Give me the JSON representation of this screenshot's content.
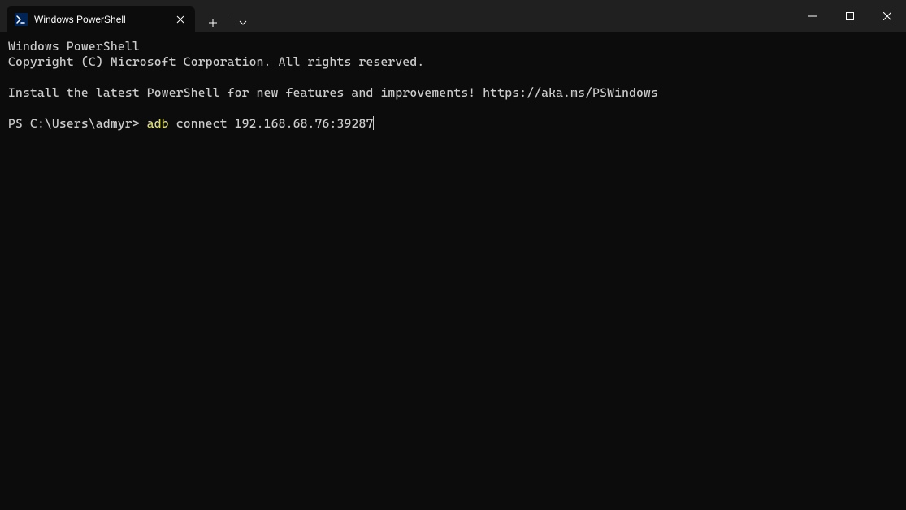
{
  "tab": {
    "title": "Windows PowerShell"
  },
  "terminal": {
    "line1": "Windows PowerShell",
    "line2": "Copyright (C) Microsoft Corporation. All rights reserved.",
    "line3": "Install the latest PowerShell for new features and improvements! https://aka.ms/PSWindows",
    "prompt": "PS C:\\Users\\admyr> ",
    "command_highlight": "adb",
    "command_rest": " connect 192.168.68.76:39287"
  }
}
